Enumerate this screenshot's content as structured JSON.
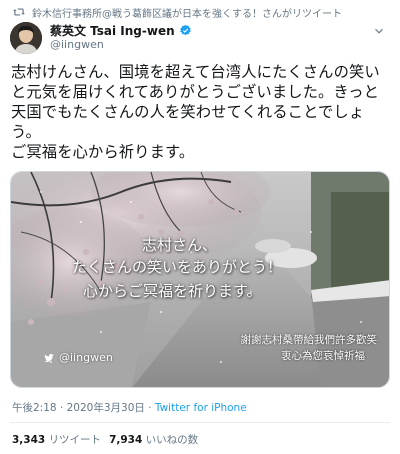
{
  "retweet": {
    "text": "鈴木信行事務所@戦う葛飾区議が日本を強くする！さんがリツイート",
    "icon": "retweet-icon"
  },
  "author": {
    "name": "蔡英文 Tsai Ing-wen",
    "handle": "@iingwen",
    "verified_icon": "verified-badge-icon",
    "avatar": "avatar"
  },
  "tweet": {
    "text": "志村けんさん、国境を超えて台湾人にたくさんの笑い\nと元気を届けくれてありがとうございました。きっと\n天国でもたくさんの人を笑わせてくれることでしょう。\nご冥福を心から祈ります。"
  },
  "media": {
    "line1": "志村さん、",
    "line2": "たくさんの笑いをありがとう！",
    "line3": "心からご冥福を祈ります。",
    "watermark_handle": "@iingwen",
    "zh_line1": "謝謝志村桑帶給我們許多歡笑",
    "zh_line2": "衷心為您哀悼祈福"
  },
  "meta": {
    "time": "午後2:18",
    "separator": "·",
    "date": "2020年3月30日",
    "source": "Twitter for iPhone"
  },
  "stats": {
    "retweets_count": "3,343",
    "retweets_label": "リツイート",
    "likes_count": "7,934",
    "likes_label": "いいねの数"
  },
  "colors": {
    "link": "#1da1f2",
    "muted": "#657786",
    "text": "#14171a"
  }
}
